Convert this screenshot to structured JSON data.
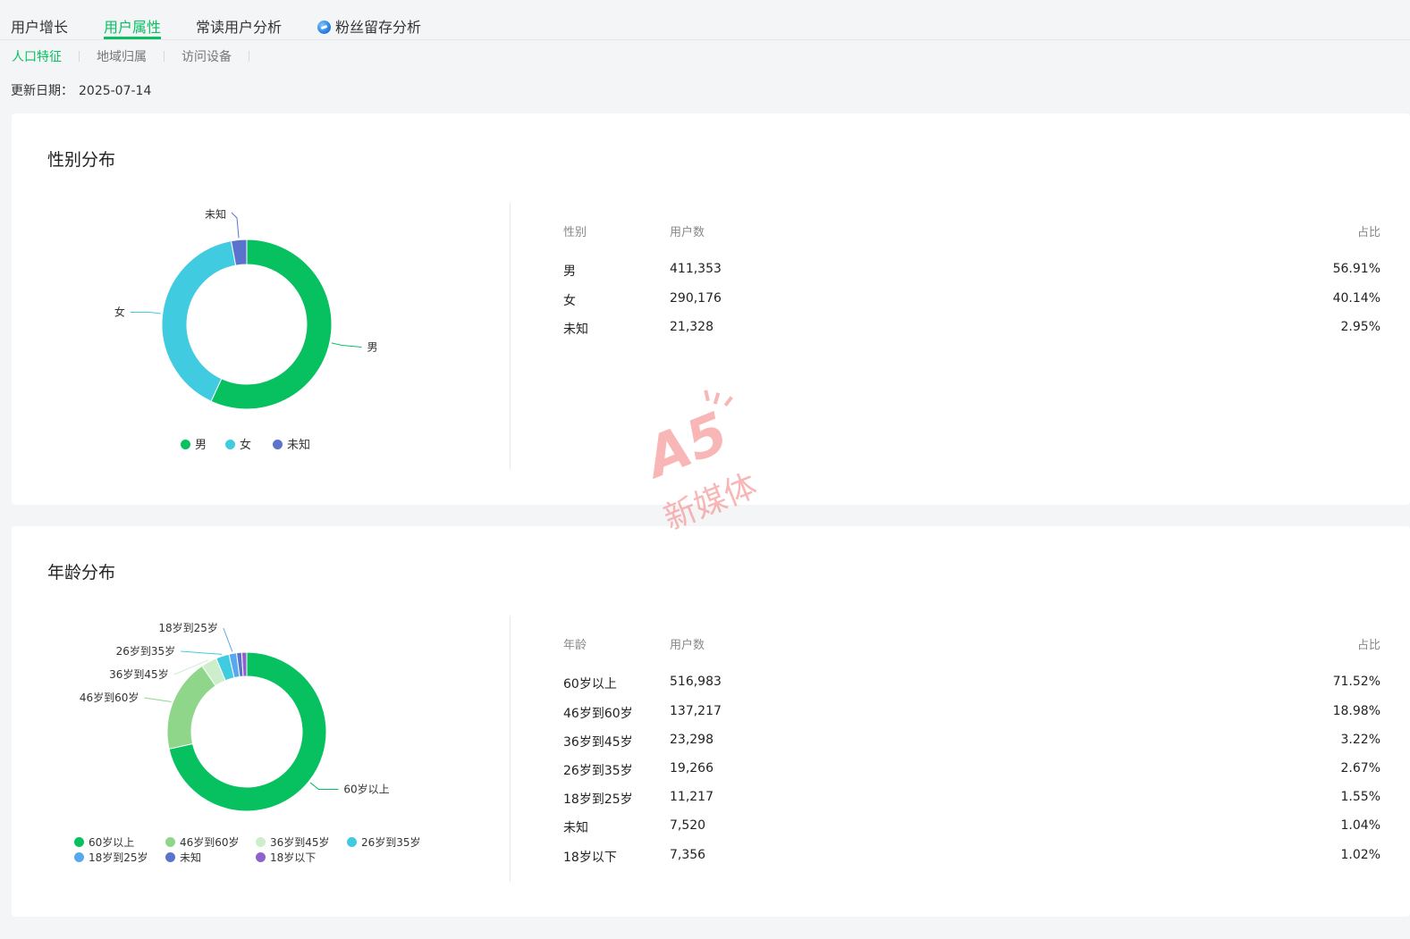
{
  "tabs": [
    {
      "label": "用户增长",
      "active": false
    },
    {
      "label": "用户属性",
      "active": true
    },
    {
      "label": "常读用户分析",
      "active": false
    },
    {
      "label": "粉丝留存分析",
      "active": false,
      "icon": "fans-retention-icon"
    }
  ],
  "subtabs": [
    {
      "label": "人口特征",
      "active": true
    },
    {
      "label": "地域归属",
      "active": false
    },
    {
      "label": "访问设备",
      "active": false
    }
  ],
  "update": {
    "label": "更新日期：",
    "date": "2025-07-14"
  },
  "colors": {
    "accent": "#07c160",
    "male": "#07c160",
    "female": "#40cbe0",
    "unknown": "#5b73cc",
    "age_60_plus": "#07c160",
    "age_46_60": "#8fd68b",
    "age_36_45": "#cdeecb",
    "age_26_35": "#40cbe0",
    "age_18_25": "#58a8f0",
    "age_unknown": "#5b73cc",
    "age_under_18": "#8e62cc"
  },
  "gender": {
    "title": "性别分布",
    "table_headers": [
      "性别",
      "用户数",
      "占比"
    ],
    "rows": [
      {
        "label": "男",
        "count": "411,353",
        "pct": "56.91%"
      },
      {
        "label": "女",
        "count": "290,176",
        "pct": "40.14%"
      },
      {
        "label": "未知",
        "count": "21,328",
        "pct": "2.95%"
      }
    ],
    "chart_labels": {
      "male": "男",
      "female": "女",
      "unknown": "未知"
    }
  },
  "age": {
    "title": "年龄分布",
    "table_headers": [
      "年龄",
      "用户数",
      "占比"
    ],
    "rows": [
      {
        "label": "60岁以上",
        "count": "516,983",
        "pct": "71.52%"
      },
      {
        "label": "46岁到60岁",
        "count": "137,217",
        "pct": "18.98%"
      },
      {
        "label": "36岁到45岁",
        "count": "23,298",
        "pct": "3.22%"
      },
      {
        "label": "26岁到35岁",
        "count": "19,266",
        "pct": "2.67%"
      },
      {
        "label": "18岁到25岁",
        "count": "11,217",
        "pct": "1.55%"
      },
      {
        "label": "未知",
        "count": "7,520",
        "pct": "1.04%"
      },
      {
        "label": "18岁以下",
        "count": "7,356",
        "pct": "1.02%"
      }
    ]
  },
  "chart_data": [
    {
      "type": "pie",
      "donut": true,
      "categories": [
        "男",
        "女",
        "未知"
      ],
      "values": [
        56.91,
        40.14,
        2.95
      ],
      "counts": [
        411353,
        290176,
        21328
      ],
      "colors": [
        "#07c160",
        "#40cbe0",
        "#5b73cc"
      ],
      "legend": [
        "男",
        "女",
        "未知"
      ],
      "legend_position": "bottom"
    },
    {
      "type": "pie",
      "donut": true,
      "categories": [
        "60岁以上",
        "46岁到60岁",
        "36岁到45岁",
        "26岁到35岁",
        "18岁到25岁",
        "未知",
        "18岁以下"
      ],
      "values": [
        71.52,
        18.98,
        3.22,
        2.67,
        1.55,
        1.04,
        1.02
      ],
      "counts": [
        516983,
        137217,
        23298,
        19266,
        11217,
        7520,
        7356
      ],
      "colors": [
        "#07c160",
        "#8fd68b",
        "#cdeecb",
        "#40cbe0",
        "#58a8f0",
        "#5b73cc",
        "#8e62cc"
      ],
      "legend": [
        "60岁以上",
        "46岁到60岁",
        "36岁到45岁",
        "26岁到35岁",
        "18岁到25岁",
        "未知",
        "18岁以下"
      ],
      "legend_position": "bottom"
    }
  ],
  "watermark": {
    "brand": "A5",
    "text": "新媒体"
  }
}
